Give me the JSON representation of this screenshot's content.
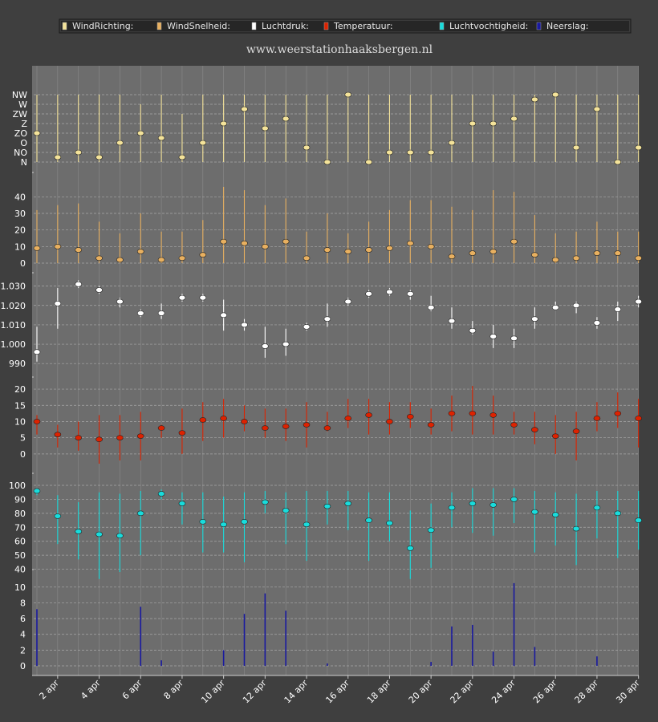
{
  "site_title": "www.weerstationhaaksbergen.nl",
  "legend": [
    {
      "label": "WindRichting:",
      "color": "#f4e39a"
    },
    {
      "label": "WindSnelheid:",
      "color": "#e8b060"
    },
    {
      "label": "Luchtdruk:",
      "color": "#ffffff"
    },
    {
      "label": "Temperatuur:",
      "color": "#dd2200"
    },
    {
      "label": "Luchtvochtigheid:",
      "color": "#19dcdc"
    },
    {
      "label": "Neerslag:",
      "color": "#1a1aa0"
    }
  ],
  "chart_data": {
    "type": "line",
    "x": [
      "1 apr",
      "2 apr",
      "3 apr",
      "4 apr",
      "5 apr",
      "6 apr",
      "7 apr",
      "8 apr",
      "9 apr",
      "10 apr",
      "11 apr",
      "12 apr",
      "13 apr",
      "14 apr",
      "15 apr",
      "16 apr",
      "17 apr",
      "18 apr",
      "19 apr",
      "20 apr",
      "21 apr",
      "22 apr",
      "23 apr",
      "24 apr",
      "25 apr",
      "26 apr",
      "27 apr",
      "28 apr",
      "29 apr",
      "30 apr"
    ],
    "x_tick_labels": [
      "2 apr",
      "4 apr",
      "6 apr",
      "8 apr",
      "10 apr",
      "12 apr",
      "14 apr",
      "16 apr",
      "18 apr",
      "20 apr",
      "22 apr",
      "24 apr",
      "26 apr",
      "28 apr",
      "30 apr"
    ],
    "grid": true,
    "panels": [
      {
        "name": "WindRichting",
        "color": "#f4e39a",
        "tick_labels": [
          "N",
          "NO",
          "O",
          "ZO",
          "Z",
          "ZW",
          "W",
          "NW"
        ],
        "ylim": [
          0,
          7
        ],
        "values": [
          3.0,
          0.5,
          1.0,
          0.5,
          2.0,
          3.0,
          2.5,
          0.5,
          2.0,
          4.0,
          5.5,
          3.5,
          4.5,
          1.5,
          0.0,
          7.0,
          0.0,
          1.0,
          1.0,
          1.0,
          2.0,
          4.0,
          4.0,
          4.5,
          6.5,
          7.0,
          1.5,
          5.5,
          0.0,
          1.5
        ],
        "min": [
          0,
          0,
          0,
          0,
          0,
          0,
          0,
          0,
          0,
          0,
          0,
          0,
          0,
          0,
          0,
          0,
          0,
          0,
          0,
          0,
          0,
          0,
          0,
          0,
          0,
          0,
          0,
          0,
          0,
          0
        ],
        "max": [
          7,
          7,
          7,
          7,
          7,
          6,
          7,
          5,
          7,
          7,
          7,
          7,
          7,
          7,
          7,
          7,
          7,
          7,
          7,
          7,
          7,
          7,
          7,
          7,
          7,
          7,
          7,
          7,
          7,
          7
        ]
      },
      {
        "name": "WindSnelheid",
        "color": "#e8b060",
        "tick_labels": [
          "0",
          "10",
          "20",
          "30",
          "40"
        ],
        "ylim": [
          0,
          45
        ],
        "values": [
          9,
          10,
          8,
          3,
          2,
          7,
          2,
          3,
          5,
          13,
          12,
          10,
          13,
          3,
          8,
          7,
          8,
          9,
          12,
          10,
          4,
          6,
          7,
          13,
          5,
          2,
          3,
          6,
          6,
          3
        ],
        "min": [
          0,
          0,
          0,
          0,
          0,
          0,
          0,
          0,
          0,
          0,
          0,
          0,
          0,
          0,
          0,
          0,
          0,
          0,
          0,
          0,
          0,
          0,
          0,
          0,
          0,
          0,
          0,
          0,
          0,
          0
        ],
        "max": [
          32,
          35,
          36,
          25,
          18,
          30,
          19,
          19,
          26,
          46,
          44,
          35,
          39,
          19,
          30,
          18,
          25,
          32,
          38,
          38,
          34,
          32,
          44,
          43,
          29,
          18,
          19,
          25,
          19,
          19
        ]
      },
      {
        "name": "Luchtdruk",
        "color": "#ffffff",
        "tick_labels": [
          "990",
          "1.000",
          "1.010",
          "1.020",
          "1.030"
        ],
        "ylim": [
          988,
          1034
        ],
        "values": [
          996,
          1021,
          1031,
          1028,
          1022,
          1016,
          1016,
          1024,
          1024,
          1015,
          1010,
          999,
          1000,
          1009,
          1013,
          1022,
          1026,
          1027,
          1026,
          1019,
          1012,
          1007,
          1004,
          1003,
          1013,
          1019,
          1020,
          1011,
          1018,
          1022
        ],
        "min": [
          991,
          1008,
          1029,
          1026,
          1019,
          1014,
          1013,
          1022,
          1022,
          1007,
          1007,
          993,
          994,
          1007,
          1009,
          1020,
          1024,
          1025,
          1023,
          1017,
          1008,
          1005,
          998,
          998,
          1008,
          1018,
          1016,
          1008,
          1012,
          1019
        ],
        "max": [
          1009,
          1029,
          1033,
          1030,
          1024,
          1018,
          1021,
          1026,
          1026,
          1023,
          1013,
          1009,
          1008,
          1011,
          1021,
          1024,
          1028,
          1029,
          1028,
          1025,
          1019,
          1012,
          1010,
          1008,
          1019,
          1022,
          1022,
          1014,
          1022,
          1025
        ]
      },
      {
        "name": "Temperatuur",
        "color": "#dd2200",
        "tick_labels": [
          "0",
          "5",
          "10",
          "15",
          "20"
        ],
        "ylim": [
          -3,
          22
        ],
        "values": [
          10.0,
          6.0,
          5.0,
          4.5,
          5.0,
          5.5,
          8.0,
          6.5,
          10.5,
          11.0,
          10.0,
          8.0,
          8.5,
          9.0,
          8.0,
          11.0,
          12.0,
          10.0,
          11.5,
          9.0,
          12.5,
          12.5,
          12.0,
          9.0,
          7.5,
          5.5,
          7.0,
          11.0,
          12.5,
          11.0
        ],
        "min": [
          6,
          2,
          1,
          -3,
          -2,
          -2,
          5,
          0,
          4,
          5,
          7,
          5,
          4,
          2,
          7,
          8,
          6,
          6,
          8,
          6,
          7,
          6,
          6,
          6,
          3,
          0,
          -2,
          7,
          8,
          2
        ],
        "max": [
          12,
          9,
          10,
          12,
          12,
          13,
          9,
          14,
          16,
          17,
          15,
          14,
          14,
          16,
          13,
          17,
          17,
          16,
          16,
          14,
          18,
          21,
          18,
          13,
          13,
          12,
          13,
          16,
          19,
          17
        ]
      },
      {
        "name": "Luchtvochtigheid",
        "color": "#19dcdc",
        "tick_labels": [
          "40",
          "50",
          "60",
          "70",
          "80",
          "90",
          "100"
        ],
        "ylim": [
          30,
          100
        ],
        "values": [
          96,
          78,
          67,
          65,
          64,
          80,
          94,
          87,
          74,
          72,
          74,
          88,
          82,
          72,
          85,
          87,
          75,
          73,
          55,
          68,
          84,
          87,
          86,
          90,
          81,
          79,
          69,
          84,
          80,
          75
        ],
        "min": [
          93,
          58,
          47,
          33,
          38,
          50,
          90,
          72,
          52,
          52,
          45,
          80,
          58,
          46,
          72,
          68,
          46,
          60,
          33,
          41,
          70,
          66,
          64,
          73,
          52,
          57,
          43,
          62,
          48,
          54
        ],
        "max": [
          98,
          93,
          88,
          95,
          94,
          96,
          97,
          95,
          95,
          92,
          95,
          96,
          95,
          96,
          96,
          96,
          95,
          95,
          82,
          87,
          95,
          98,
          98,
          98,
          96,
          95,
          94,
          96,
          96,
          96
        ]
      },
      {
        "name": "Neerslag",
        "color": "#1a1aa0",
        "tick_labels": [
          "0",
          "2",
          "4",
          "6",
          "8",
          "10"
        ],
        "ylim": [
          0,
          11
        ],
        "values": [
          7.2,
          0,
          0,
          0,
          0,
          7.5,
          0.7,
          0,
          0,
          2.0,
          6.6,
          9.2,
          7.0,
          0,
          0.3,
          0,
          0,
          0,
          0,
          0.5,
          5.0,
          5.2,
          1.8,
          10.5,
          2.4,
          0,
          0,
          1.2,
          0,
          0
        ]
      }
    ]
  }
}
